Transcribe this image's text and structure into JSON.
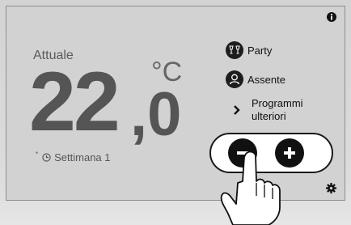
{
  "display": {
    "current_label": "Attuale",
    "temperature_integer": "22",
    "temperature_decimal": ",0",
    "unit": "°C",
    "schedule_superscript": "*",
    "schedule_label": "Settimana 1"
  },
  "menu": {
    "party_label": "Party",
    "absent_label": "Assente",
    "more_programs_line1": "Programmi",
    "more_programs_line2": "ulteriori"
  },
  "icons": {
    "info": "info-icon",
    "party": "party-glasses-icon",
    "absent": "away-person-icon",
    "more": "chevron-right-icon",
    "minus": "minus-icon",
    "plus": "plus-icon",
    "settings": "gear-icon",
    "clock": "clock-icon"
  },
  "colors": {
    "screen_background": "#d2d2d2",
    "icon_fill": "#1d1d1d",
    "temperature_text": "#555555"
  }
}
